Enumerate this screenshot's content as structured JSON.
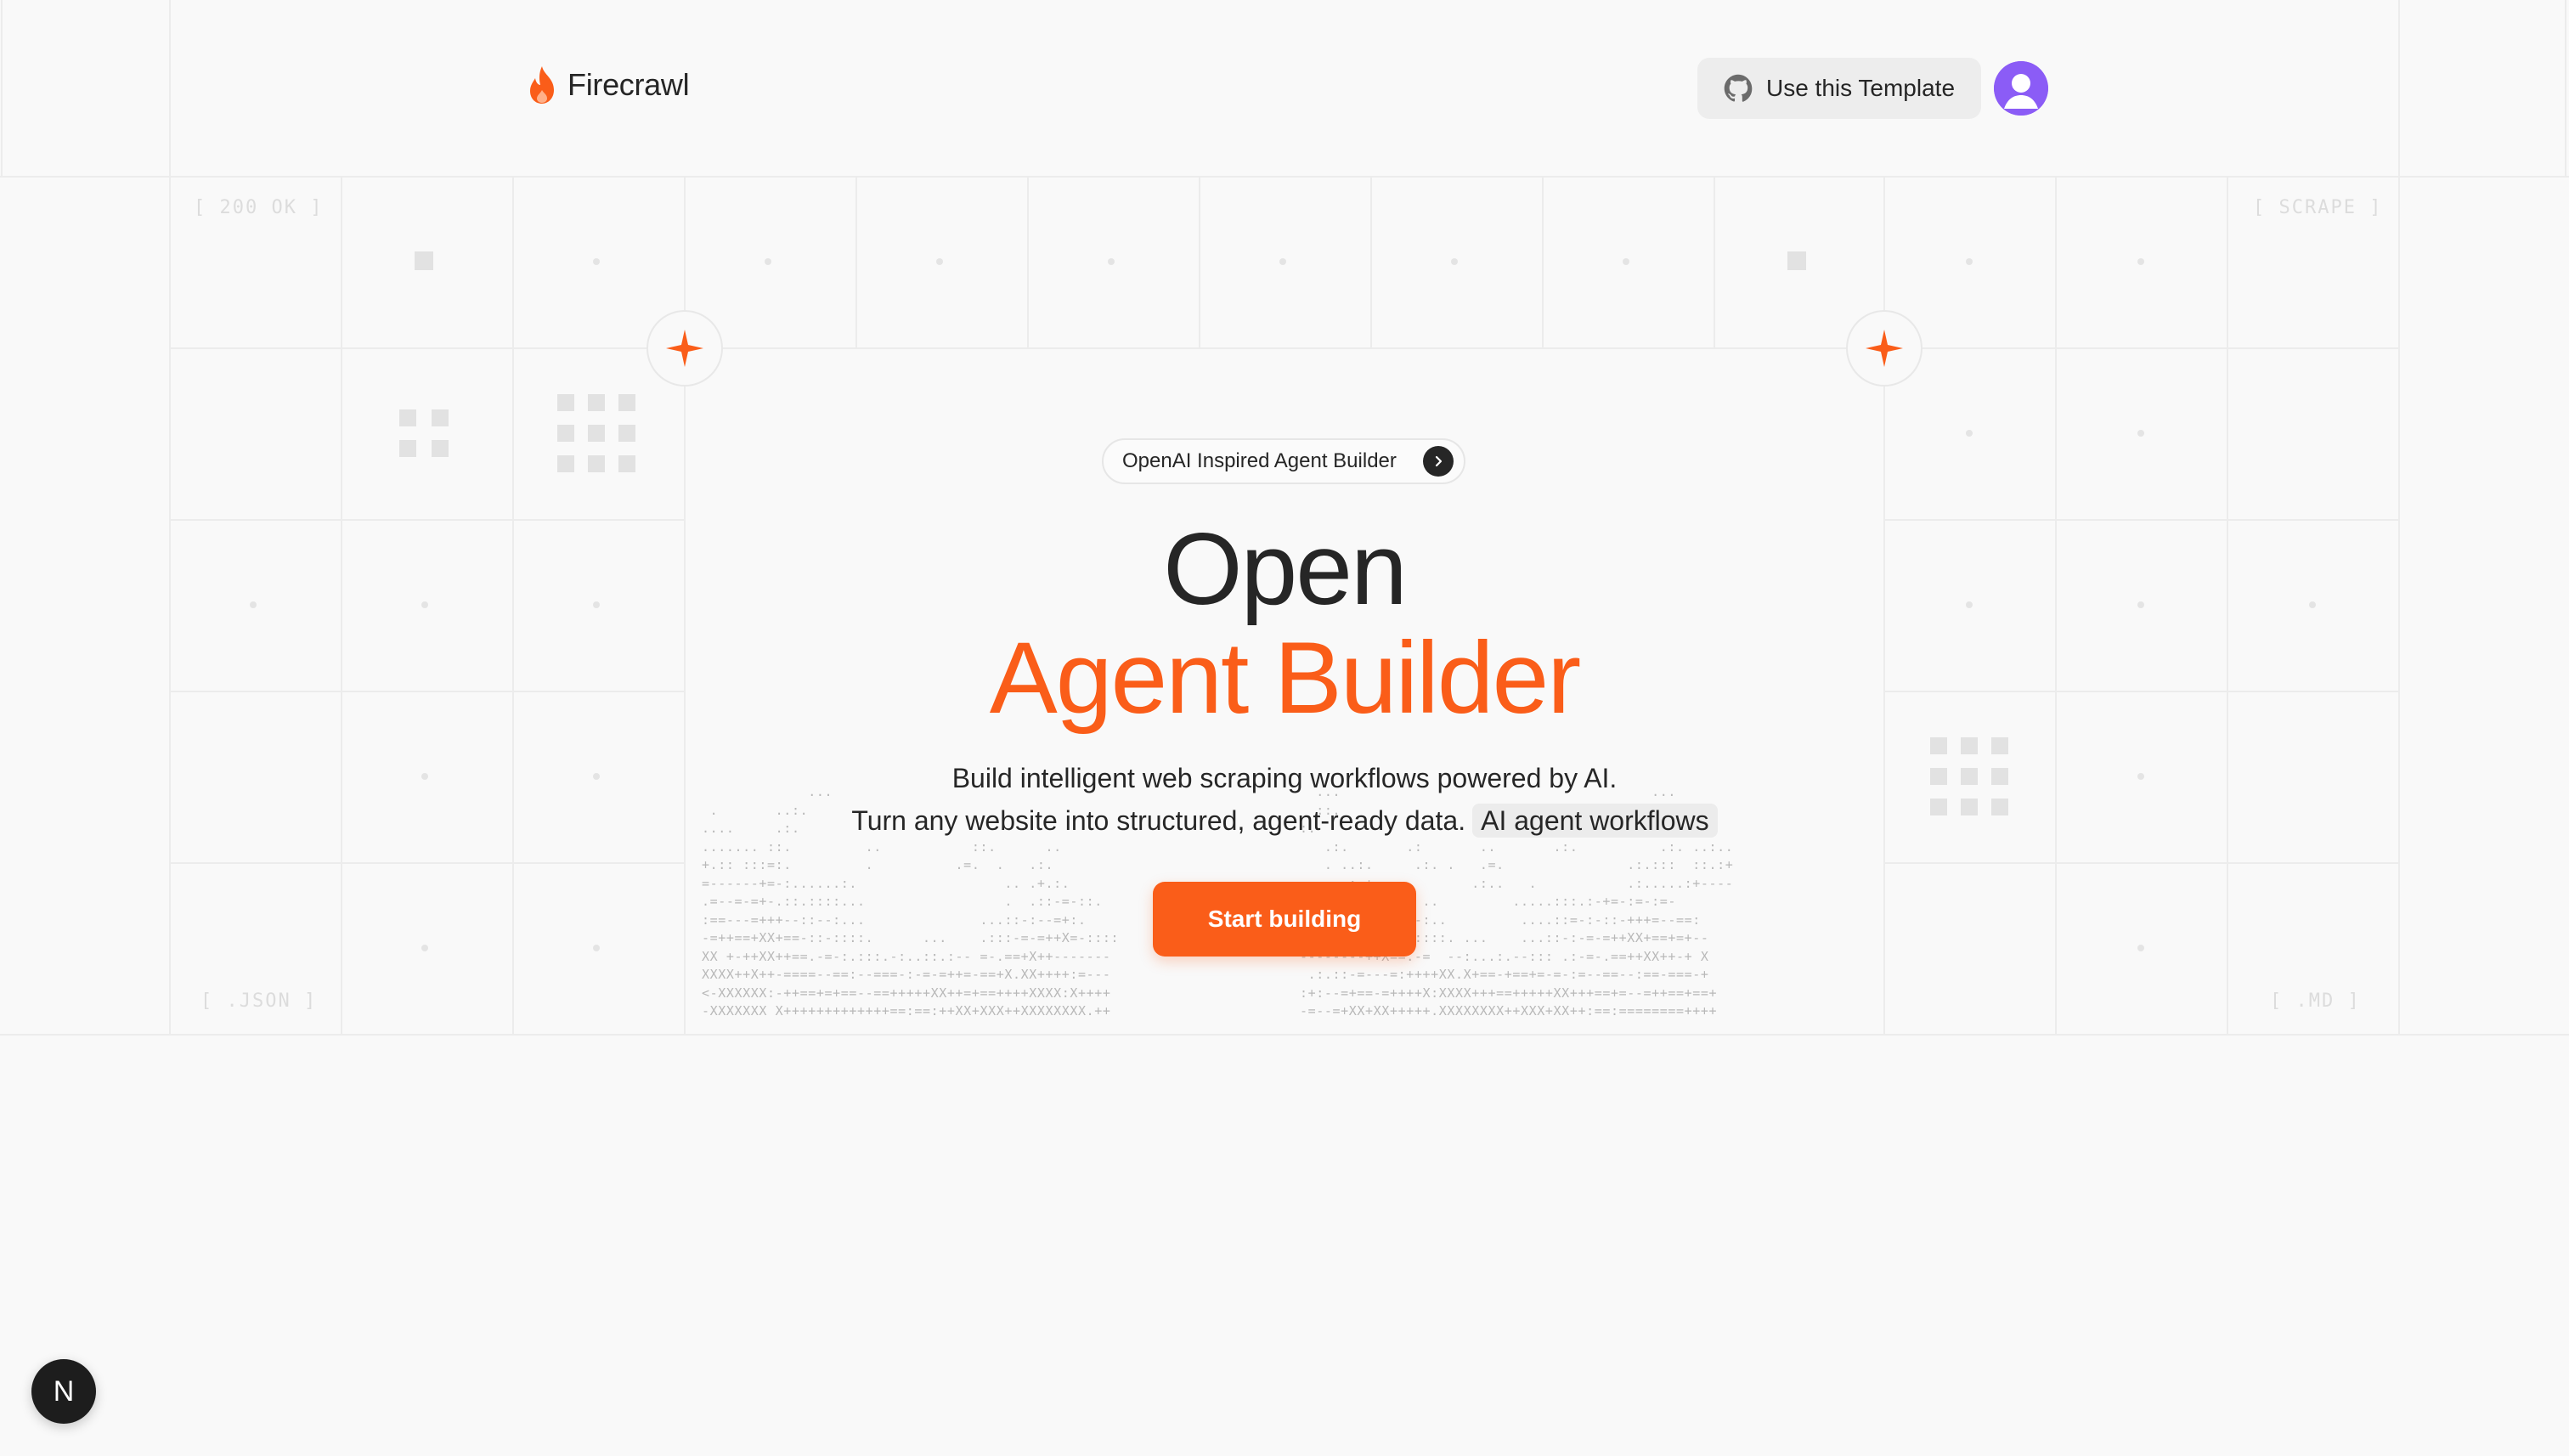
{
  "brand": {
    "name": "Firecrawl",
    "accent": "#fa5d19"
  },
  "header": {
    "template_button": "Use this Template",
    "template_icon": "github-icon",
    "avatar_icon": "user-icon"
  },
  "tags": {
    "top_left": "[ 200 OK ]",
    "top_right": "[ SCRAPE ]",
    "bottom_left": "[ .JSON ]",
    "bottom_right": "[ .MD ]"
  },
  "hero": {
    "badge": "OpenAI Inspired Agent Builder",
    "badge_icon": "chevron-right-icon",
    "title_line1": "Open",
    "title_line2": "Agent Builder",
    "subtitle_line1": "Build intelligent web scraping workflows powered by AI.",
    "subtitle_line2": "Turn any website into structured, agent-ready data.",
    "subtitle_highlight": "AI agent workflows",
    "cta": "Start building"
  },
  "dev_badge": "N",
  "ascii_art": {
    "left": "             ...\n .       ..:.\n....     .:.\n....... ::.         ..           ::.      ..\n+.:: :::=:.         .          .=.  .   .:.\n=------+=-:......:.                  .. .+.:.\n.=--=-=+-.::.::::...                 .  .::-=-::.\n:==---=+++--::--:...              ...::-:--=+:.\n-=++==+XX+==-::-::::.      ...    .:::-=-=++X=-::::\nXX +-++XX++==.-=-:.:::.-:..::.:-- =-.==+X++-------\nXXXX++X++-====--==:--===-:-=-=++=-==+X.XX++++:=---\n<-XXXXXX:-++==+=+==--==+++++XX++=+==++++XXXX:X++++\n-XXXXXXX X+++++++++++++==:==:++XX+XXX++XXXXXXXX.++",
    "right": "  ...                                      ...\n  ::.                                      .:.\n:.                                         ..  .\n   .:.       .:       ..       .:.          .:. ..:..\n   . ..:.     .:. .   .=.               .:.:::  ::.:+\n    ..:.+.           .:..   .           .:.....:+----\n     .::-=-:.  ..         .....:::.:-+=-:=-:=-\n    .:+==-:-:--:..         ....::=-:-::-+++=--==:\n   .=-:X++=-=-::::. ...    ...::-:-=-=++XX+==+=+--\n--------++X==.-=  --:...:.--::: .:-=-.==++XX++-+ X\n .:.::-=---=:++++XX.X+==-+==+=-=-:=--==--:==-===-+\n:+:--=+==-=++++X:XXXX+++==+++++XX+++==+=--=++==+==+\n-=--=+XX+XX+++++.XXXXXXXX++XXX+XX++:==:========++++"
  }
}
